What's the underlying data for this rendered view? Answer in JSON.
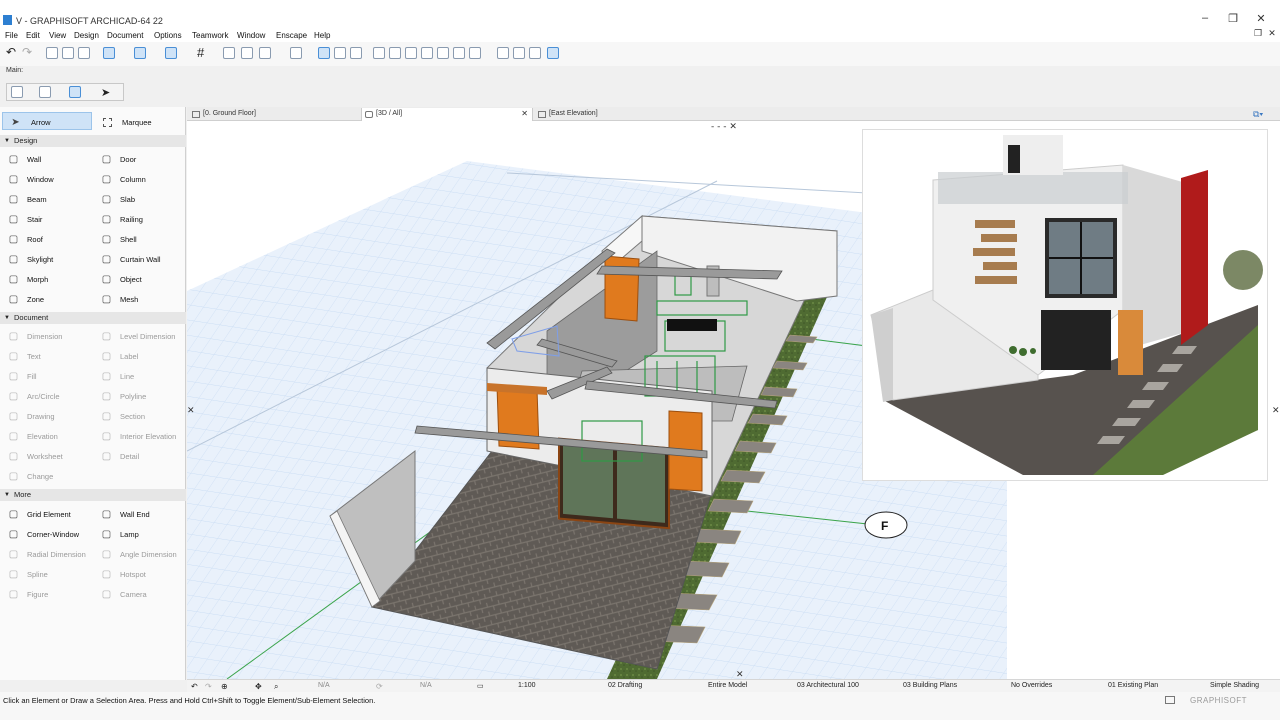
{
  "window": {
    "title": "V - GRAPHISOFT ARCHICAD-64 22"
  },
  "menu": [
    "File",
    "Edit",
    "View",
    "Design",
    "Document",
    "Options",
    "Teamwork",
    "Window",
    "Enscape",
    "Help"
  ],
  "toolbar": {
    "main_label": "Main:"
  },
  "toolbox": {
    "arrow": "Arrow",
    "marquee": "Marquee",
    "sections": {
      "design": "Design",
      "document": "Document",
      "more": "More"
    },
    "design_tools": [
      {
        "label": "Wall",
        "icon": "wall-icon"
      },
      {
        "label": "Door",
        "icon": "door-icon"
      },
      {
        "label": "Window",
        "icon": "window-icon"
      },
      {
        "label": "Column",
        "icon": "column-icon"
      },
      {
        "label": "Beam",
        "icon": "beam-icon"
      },
      {
        "label": "Slab",
        "icon": "slab-icon"
      },
      {
        "label": "Stair",
        "icon": "stair-icon"
      },
      {
        "label": "Railing",
        "icon": "railing-icon"
      },
      {
        "label": "Roof",
        "icon": "roof-icon"
      },
      {
        "label": "Shell",
        "icon": "shell-icon"
      },
      {
        "label": "Skylight",
        "icon": "skylight-icon"
      },
      {
        "label": "Curtain Wall",
        "icon": "curtain-wall-icon"
      },
      {
        "label": "Morph",
        "icon": "morph-icon"
      },
      {
        "label": "Object",
        "icon": "object-icon"
      },
      {
        "label": "Zone",
        "icon": "zone-icon"
      },
      {
        "label": "Mesh",
        "icon": "mesh-icon"
      }
    ],
    "document_tools": [
      {
        "label": "Dimension",
        "icon": "dimension-icon"
      },
      {
        "label": "Level Dimension",
        "icon": "level-dimension-icon"
      },
      {
        "label": "Text",
        "icon": "text-icon"
      },
      {
        "label": "Label",
        "icon": "label-icon"
      },
      {
        "label": "Fill",
        "icon": "fill-icon"
      },
      {
        "label": "Line",
        "icon": "line-icon"
      },
      {
        "label": "Arc/Circle",
        "icon": "arc-icon"
      },
      {
        "label": "Polyline",
        "icon": "polyline-icon"
      },
      {
        "label": "Drawing",
        "icon": "drawing-icon"
      },
      {
        "label": "Section",
        "icon": "section-icon"
      },
      {
        "label": "Elevation",
        "icon": "elevation-icon"
      },
      {
        "label": "Interior Elevation",
        "icon": "interior-elevation-icon"
      },
      {
        "label": "Worksheet",
        "icon": "worksheet-icon"
      },
      {
        "label": "Detail",
        "icon": "detail-icon"
      },
      {
        "label": "Change",
        "icon": "change-icon"
      }
    ],
    "more_tools": [
      {
        "label": "Grid Element",
        "icon": "grid-element-icon",
        "enabled": true
      },
      {
        "label": "Wall End",
        "icon": "wall-end-icon",
        "enabled": true
      },
      {
        "label": "Corner-Window",
        "icon": "corner-window-icon",
        "enabled": true
      },
      {
        "label": "Lamp",
        "icon": "lamp-icon",
        "enabled": true
      },
      {
        "label": "Radial Dimension",
        "icon": "radial-dimension-icon",
        "enabled": false
      },
      {
        "label": "Angle Dimension",
        "icon": "angle-dimension-icon",
        "enabled": false
      },
      {
        "label": "Spline",
        "icon": "spline-icon",
        "enabled": false
      },
      {
        "label": "Hotspot",
        "icon": "hotspot-icon",
        "enabled": false
      },
      {
        "label": "Figure",
        "icon": "figure-icon",
        "enabled": false
      },
      {
        "label": "Camera",
        "icon": "camera-icon",
        "enabled": false
      }
    ]
  },
  "tabs": [
    {
      "label": "[0. Ground Floor]",
      "icon": "floor-plan-icon"
    },
    {
      "label": "[3D / All]",
      "icon": "3d-icon",
      "active": true
    },
    {
      "label": "[East Elevation]",
      "icon": "elevation-icon"
    }
  ],
  "viewport": {
    "grid_marker": "F"
  },
  "status": {
    "na1": "N/A",
    "na2": "N/A",
    "scale": "1:100",
    "layer_combo": "02 Drafting",
    "model_view": "Entire Model",
    "pen_set": "03 Architectural 100",
    "mvo": "03 Building Plans",
    "overrides": "No Overrides",
    "renovation": "01 Existing Plan",
    "shading": "Simple Shading"
  },
  "hint": "Click an Element or Draw a Selection Area. Press and Hold Ctrl+Shift to Toggle Element/Sub-Element Selection.",
  "brand": "GRAPHISOFT",
  "colors": {
    "accent": "#cfe3f7",
    "grid": "#c9dcf3",
    "paving": "#5f5a55",
    "grass": "#4f6b32",
    "door": "#e07a1e"
  }
}
